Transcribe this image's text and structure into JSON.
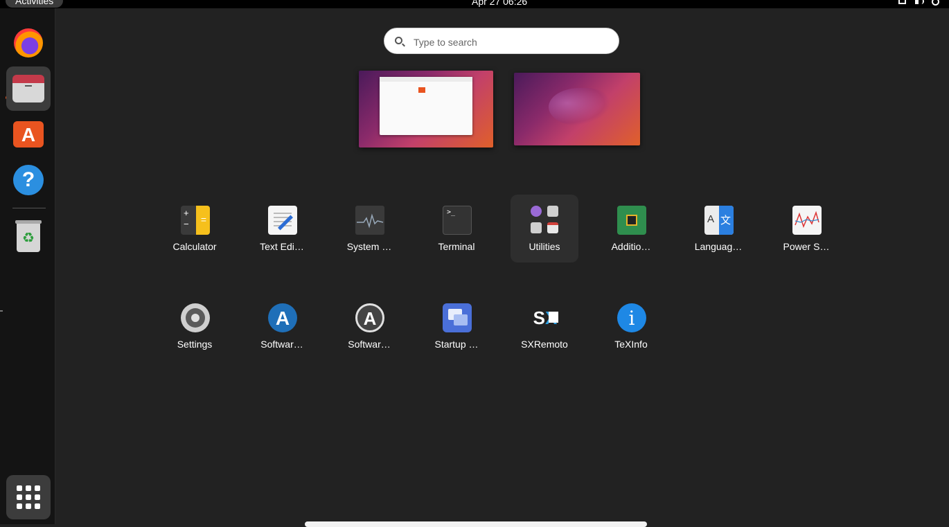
{
  "topbar": {
    "activities_label": "Activities",
    "clock": "Apr 27  06:26",
    "tray_icons": [
      "network-icon",
      "volume-icon",
      "power-icon"
    ]
  },
  "dock": {
    "items": [
      {
        "name": "firefox",
        "icon": "firefox-icon"
      },
      {
        "name": "files",
        "icon": "files-icon",
        "running": true
      },
      {
        "name": "ubuntu-software",
        "icon": "store-icon"
      },
      {
        "name": "help",
        "icon": "help-icon"
      },
      {
        "name": "trash",
        "icon": "trash-icon"
      }
    ],
    "show_apps_icon": "app-grid-icon"
  },
  "search": {
    "placeholder": "Type to search",
    "value": ""
  },
  "workspaces": [
    {
      "name": "workspace-1",
      "has_window": true
    },
    {
      "name": "workspace-2",
      "has_window": false
    }
  ],
  "apps": {
    "row1": [
      {
        "label": "Calculator",
        "icon": "calculator-icon"
      },
      {
        "label": "Text Edi…",
        "icon": "text-editor-icon"
      },
      {
        "label": "System …",
        "icon": "system-monitor-icon"
      },
      {
        "label": "Terminal",
        "icon": "terminal-icon"
      },
      {
        "label": "Utilities",
        "icon": "utilities-folder-icon"
      },
      {
        "label": "Additio…",
        "icon": "additional-drivers-icon"
      },
      {
        "label": "Languag…",
        "icon": "language-support-icon"
      },
      {
        "label": "Power S…",
        "icon": "power-statistics-icon"
      }
    ],
    "row2": [
      {
        "label": "Settings",
        "icon": "settings-icon"
      },
      {
        "label": "Softwar…",
        "icon": "software-updater-icon"
      },
      {
        "label": "Softwar…",
        "icon": "software-properties-icon"
      },
      {
        "label": "Startup …",
        "icon": "startup-applications-icon"
      },
      {
        "label": "SXRemoto",
        "icon": "sxremoto-icon"
      },
      {
        "label": "TeXInfo",
        "icon": "texinfo-icon"
      }
    ]
  },
  "colors": {
    "background": "#222222",
    "topbar": "#000000",
    "dock": "#141414",
    "accent": "#e95420"
  }
}
